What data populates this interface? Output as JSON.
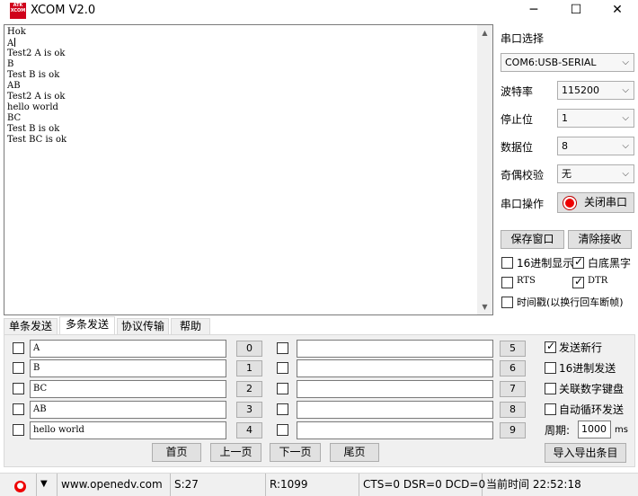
{
  "window": {
    "title": "XCOM V2.0",
    "logo_text": "ATK XCOM",
    "minimize": "─",
    "maximize": "☐",
    "close": "✕"
  },
  "receive": {
    "lines": [
      "Hok",
      "A",
      "Test2 A is ok",
      "B",
      "Test B is ok",
      "AB",
      "Test2 A is ok",
      "hello world",
      "BC",
      "Test B is ok",
      "Test BC is ok"
    ]
  },
  "right": {
    "port_select_label": "串口选择",
    "port_value": "COM6:USB-SERIAL",
    "baud_label": "波特率",
    "baud_value": "115200",
    "stop_label": "停止位",
    "stop_value": "1",
    "data_label": "数据位",
    "data_value": "8",
    "parity_label": "奇偶校验",
    "parity_value": "无",
    "op_label": "串口操作",
    "op_button": "关闭串口",
    "save_button": "保存窗口",
    "clear_button": "清除接收",
    "hex_display": "16进制显示",
    "white_black": "白底黑字",
    "rts": "RTS",
    "dtr": "DTR",
    "timestamp": "时间戳(以换行回车断帧)"
  },
  "tabs": [
    "单条发送",
    "多条发送",
    "协议传输",
    "帮助"
  ],
  "multi": {
    "left_rows": [
      {
        "text": "A",
        "num": "0"
      },
      {
        "text": "B",
        "num": "1"
      },
      {
        "text": "BC",
        "num": "2"
      },
      {
        "text": "AB",
        "num": "3"
      },
      {
        "text": "hello world",
        "num": "4"
      }
    ],
    "right_rows": [
      {
        "text": "",
        "num": "5"
      },
      {
        "text": "",
        "num": "6"
      },
      {
        "text": "",
        "num": "7"
      },
      {
        "text": "",
        "num": "8"
      },
      {
        "text": "",
        "num": "9"
      }
    ],
    "send_newline": "发送新行",
    "hex_send": "16进制发送",
    "keypad": "关联数字键盘",
    "auto_loop": "自动循环发送",
    "period_label": "周期:",
    "period_value": "1000",
    "period_unit": "ms",
    "import_export": "导入导出条目",
    "first_page": "首页",
    "prev_page": "上一页",
    "next_page": "下一页",
    "last_page": "尾页"
  },
  "status": {
    "url": "www.openedv.com",
    "sent": "S:27",
    "received": "R:1099",
    "lines": "CTS=0 DSR=0 DCD=0",
    "time": "当前时间 22:52:18"
  }
}
